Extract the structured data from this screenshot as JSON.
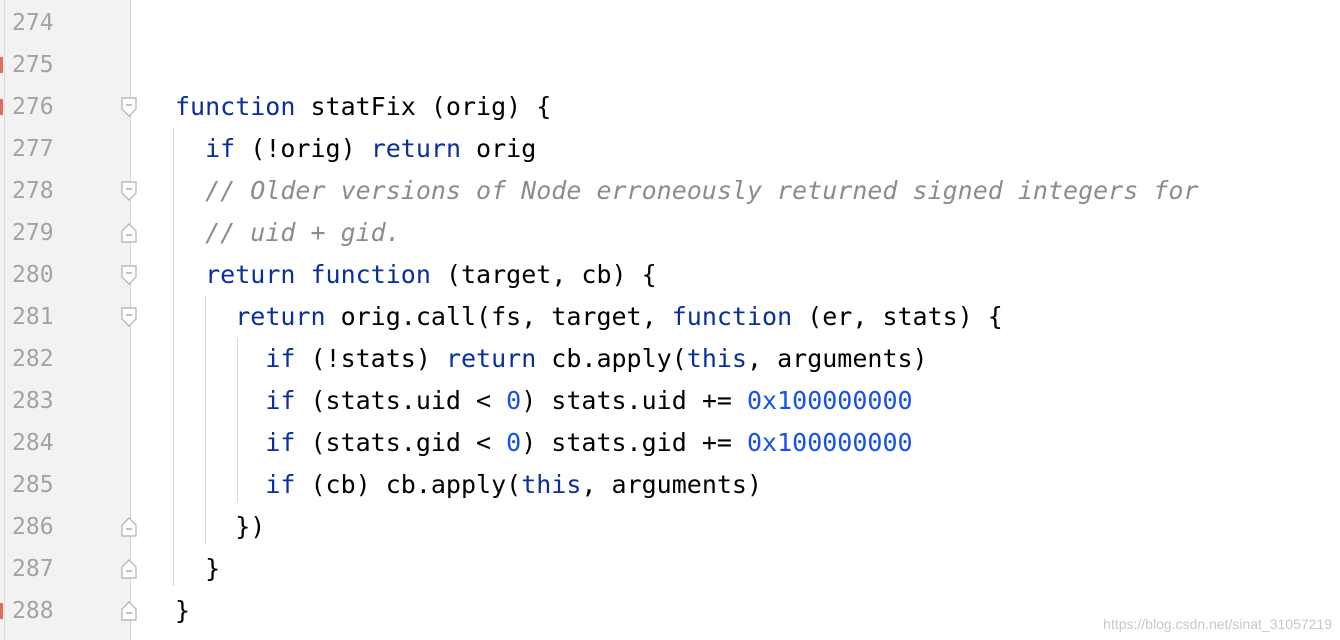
{
  "editor": {
    "lines": [
      {
        "number": "274",
        "tokens": []
      },
      {
        "number": "275",
        "tokens": []
      },
      {
        "number": "276",
        "tokens": [
          {
            "t": "function",
            "c": "kw"
          },
          {
            "t": " statFix (orig) {",
            "c": ""
          }
        ]
      },
      {
        "number": "277",
        "tokens": [
          {
            "t": "  ",
            "c": ""
          },
          {
            "t": "if",
            "c": "kw"
          },
          {
            "t": " (!orig) ",
            "c": ""
          },
          {
            "t": "return",
            "c": "kw"
          },
          {
            "t": " orig",
            "c": ""
          }
        ]
      },
      {
        "number": "278",
        "tokens": [
          {
            "t": "  ",
            "c": ""
          },
          {
            "t": "// Older versions of Node erroneously returned signed integers for",
            "c": "cmt"
          }
        ]
      },
      {
        "number": "279",
        "tokens": [
          {
            "t": "  ",
            "c": ""
          },
          {
            "t": "// uid + gid.",
            "c": "cmt"
          }
        ]
      },
      {
        "number": "280",
        "tokens": [
          {
            "t": "  ",
            "c": ""
          },
          {
            "t": "return",
            "c": "kw"
          },
          {
            "t": " ",
            "c": ""
          },
          {
            "t": "function",
            "c": "kw"
          },
          {
            "t": " (target, cb) {",
            "c": ""
          }
        ]
      },
      {
        "number": "281",
        "tokens": [
          {
            "t": "    ",
            "c": ""
          },
          {
            "t": "return",
            "c": "kw"
          },
          {
            "t": " orig.call(fs, target, ",
            "c": ""
          },
          {
            "t": "function",
            "c": "kw"
          },
          {
            "t": " (er, stats) {",
            "c": ""
          }
        ]
      },
      {
        "number": "282",
        "tokens": [
          {
            "t": "      ",
            "c": ""
          },
          {
            "t": "if",
            "c": "kw"
          },
          {
            "t": " (!stats) ",
            "c": ""
          },
          {
            "t": "return",
            "c": "kw"
          },
          {
            "t": " cb.apply(",
            "c": ""
          },
          {
            "t": "this",
            "c": "kw"
          },
          {
            "t": ", arguments)",
            "c": ""
          }
        ]
      },
      {
        "number": "283",
        "tokens": [
          {
            "t": "      ",
            "c": ""
          },
          {
            "t": "if",
            "c": "kw"
          },
          {
            "t": " (stats.uid < ",
            "c": ""
          },
          {
            "t": "0",
            "c": "num"
          },
          {
            "t": ") stats.uid += ",
            "c": ""
          },
          {
            "t": "0x100000000",
            "c": "num"
          }
        ]
      },
      {
        "number": "284",
        "tokens": [
          {
            "t": "      ",
            "c": ""
          },
          {
            "t": "if",
            "c": "kw"
          },
          {
            "t": " (stats.gid < ",
            "c": ""
          },
          {
            "t": "0",
            "c": "num"
          },
          {
            "t": ") stats.gid += ",
            "c": ""
          },
          {
            "t": "0x100000000",
            "c": "num"
          }
        ]
      },
      {
        "number": "285",
        "tokens": [
          {
            "t": "      ",
            "c": ""
          },
          {
            "t": "if",
            "c": "kw"
          },
          {
            "t": " (cb) cb.apply(",
            "c": ""
          },
          {
            "t": "this",
            "c": "kw"
          },
          {
            "t": ", arguments)",
            "c": ""
          }
        ]
      },
      {
        "number": "286",
        "tokens": [
          {
            "t": "    })",
            "c": ""
          }
        ]
      },
      {
        "number": "287",
        "tokens": [
          {
            "t": "  }",
            "c": ""
          }
        ]
      },
      {
        "number": "288",
        "tokens": [
          {
            "t": "}",
            "c": ""
          }
        ]
      }
    ],
    "fold_markers": [
      {
        "line": 2,
        "kind": "open"
      },
      {
        "line": 4,
        "kind": "open"
      },
      {
        "line": 5,
        "kind": "close"
      },
      {
        "line": 6,
        "kind": "open"
      },
      {
        "line": 7,
        "kind": "open"
      },
      {
        "line": 12,
        "kind": "close"
      },
      {
        "line": 13,
        "kind": "close"
      },
      {
        "line": 14,
        "kind": "close"
      }
    ],
    "change_marker_lines": [
      1,
      2,
      14
    ]
  },
  "colors": {
    "keyword": "#0a2e9c",
    "number": "#1750eb",
    "comment": "#8c8c8c",
    "text": "#000000",
    "gutter_bg": "#f2f2f2",
    "line_number": "#a3a3a3"
  },
  "watermark": "https://blog.csdn.net/sinat_31057219"
}
